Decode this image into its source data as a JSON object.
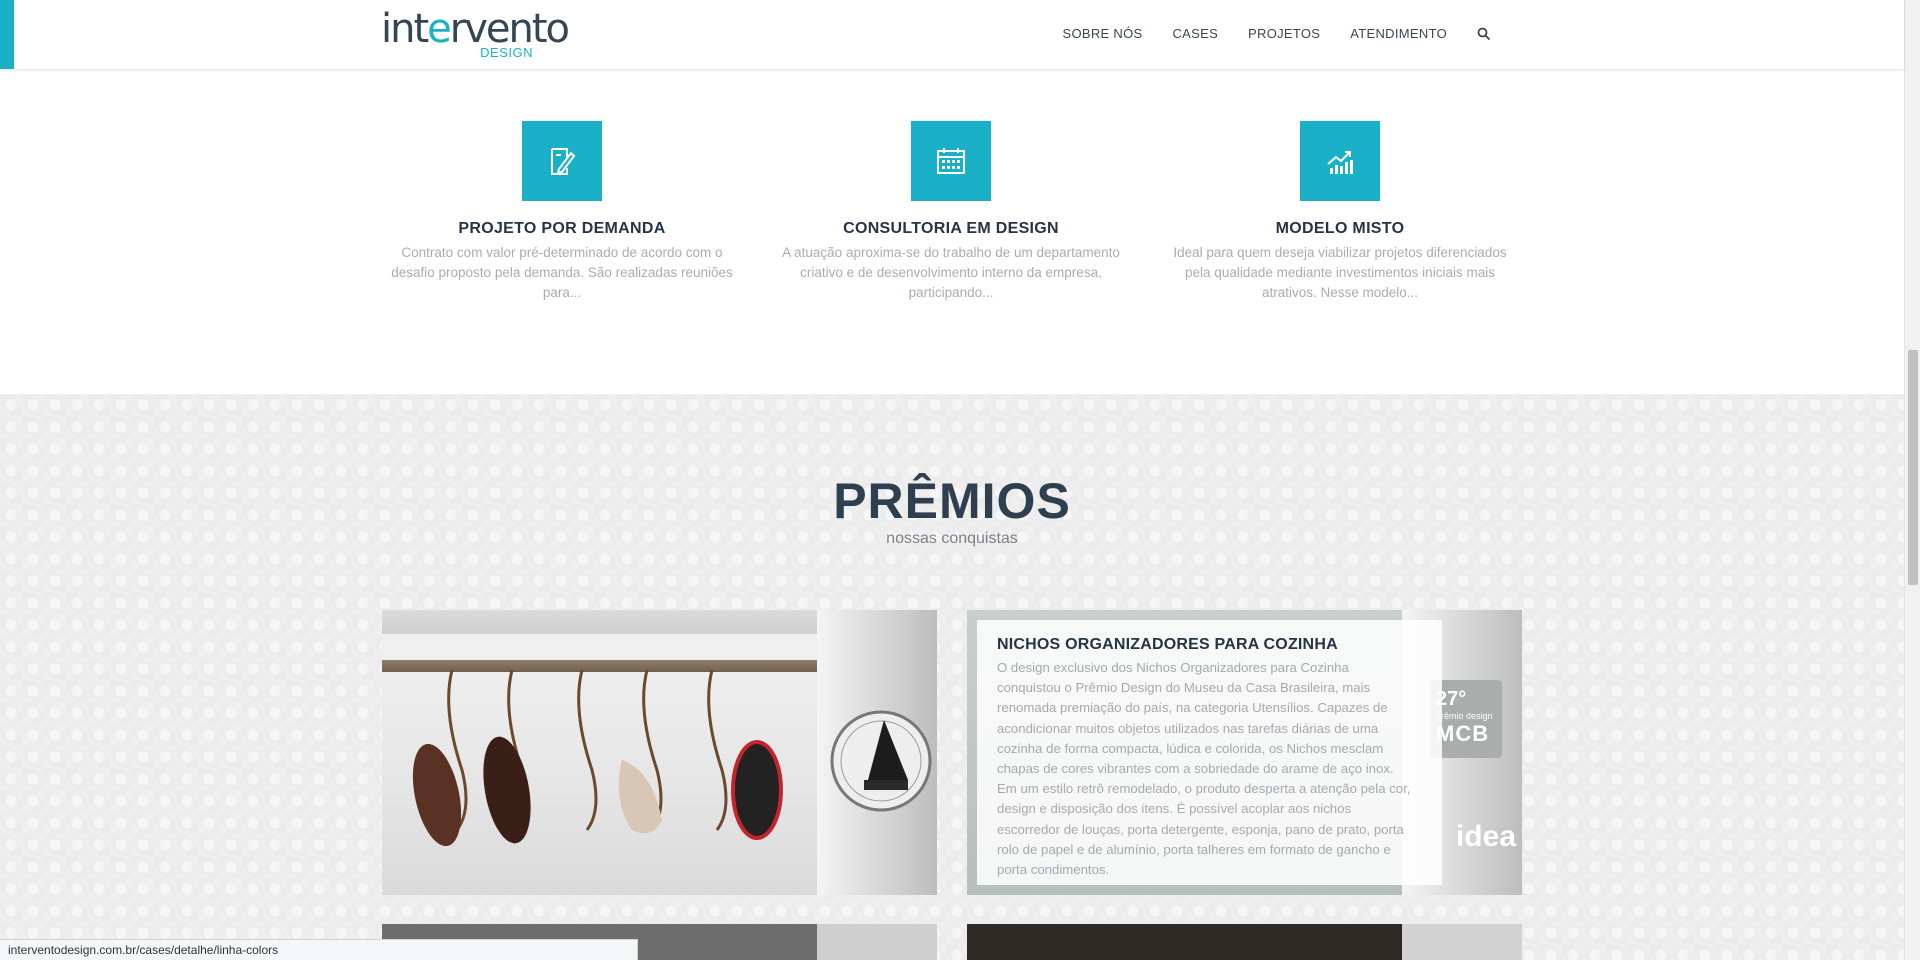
{
  "header": {
    "logo": {
      "main": "intervento",
      "sub": "DESIGN"
    },
    "nav": [
      "SOBRE NÓS",
      "CASES",
      "PROJETOS",
      "ATENDIMENTO"
    ],
    "search_icon": "search-icon",
    "accent_color": "#1ab0c8"
  },
  "services": [
    {
      "icon": "document-edit-icon",
      "title": "PROJETO POR DEMANDA",
      "desc": "Contrato com valor pré-determinado de acordo com o desafio proposto pela demanda. São realizadas reuniões para..."
    },
    {
      "icon": "calendar-icon",
      "title": "CONSULTORIA EM DESIGN",
      "desc": "A atuação aproxima-se do trabalho de um departamento criativo e de desenvolvimento interno da empresa, participando..."
    },
    {
      "icon": "growth-chart-icon",
      "title": "MODELO MISTO",
      "desc": "Ideal para quem deseja viabilizar projetos diferenciados pela qualidade mediante investimentos iniciais mais atrativos. Nesse modelo..."
    }
  ],
  "awards": {
    "title": "PRÊMIOS",
    "subtitle": "nossas conquistas",
    "card_right": {
      "title": "NICHOS ORGANIZADORES PARA COZINHA",
      "text": "O design exclusivo dos Nichos Organizadores para Cozinha conquistou o Prêmio Design do Museu da Casa Brasileira, mais renomada premiação do país, na categoria Utensílios. Capazes de acondicionar muitos objetos utilizados nas tarefas diárias de uma cozinha de forma compacta, lúdica e colorida, os Nichos mesclam chapas de cores vibrantes com a sobriedade do arame de aço inox. Em um estilo retrô remodelado, o produto desperta a atenção pela cor, design e disposição dos itens. É possível acoplar aos nichos escorredor de louças, porta detergente, esponja, pano de prato, porta rolo de papel e de alumínio, porta talheres em formato de gancho e porta condimentos.",
      "badge_27": "27°",
      "badge_27_sub": "prêmio design",
      "badge_mcb": "MCB",
      "badge_idea": "idea"
    }
  },
  "status_bar": {
    "url": "interventodesign.com.br/cases/detalhe/linha-colors"
  }
}
